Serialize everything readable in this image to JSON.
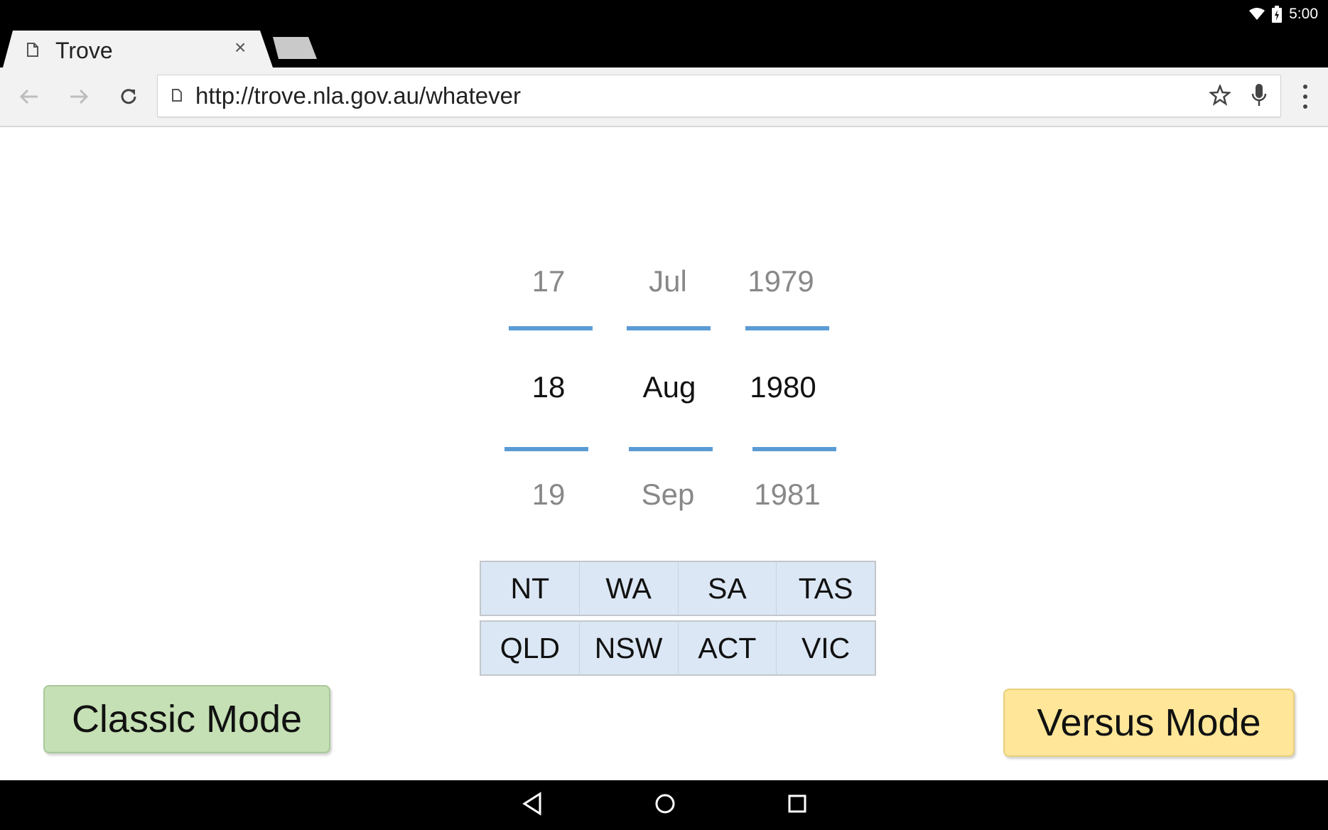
{
  "status": {
    "time": "5:00",
    "icons": [
      "wifi-icon",
      "battery-charging-icon"
    ]
  },
  "browser": {
    "tab_title": "Trove",
    "tab_close": "×",
    "url": "http://trove.nla.gov.au/whatever"
  },
  "picker": {
    "day": {
      "prev": "17",
      "current": "18",
      "next": "19"
    },
    "month": {
      "prev": "Jul",
      "current": "Aug",
      "next": "Sep"
    },
    "year": {
      "prev": "1979",
      "current": "1980",
      "next": "1981"
    }
  },
  "states": {
    "row1": [
      "NT",
      "WA",
      "SA",
      "TAS"
    ],
    "row2": [
      "QLD",
      "NSW",
      "ACT",
      "VIC"
    ]
  },
  "modes": {
    "classic": "Classic Mode",
    "versus": "Versus Mode"
  },
  "colors": {
    "accent_line": "#5b9bd5",
    "states_bg": "#dbe7f4",
    "classic_bg": "#c5e0b4",
    "versus_bg": "#ffe699"
  }
}
